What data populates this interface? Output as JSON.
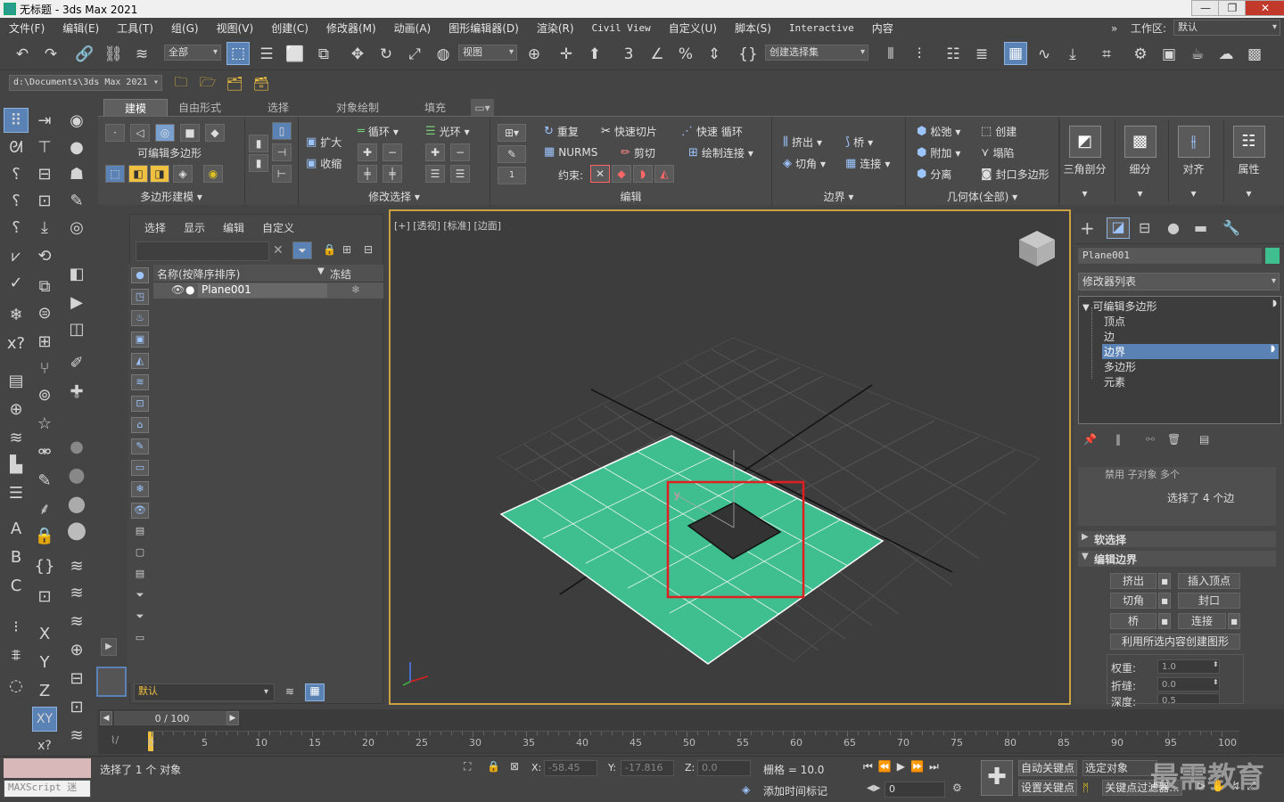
{
  "window": {
    "title": "无标题 - 3ds Max 2021",
    "buttons": [
      "—",
      "❐",
      "✕"
    ]
  },
  "menu": {
    "items": [
      "文件(F)",
      "编辑(E)",
      "工具(T)",
      "组(G)",
      "视图(V)",
      "创建(C)",
      "修改器(M)",
      "动画(A)",
      "图形编辑器(D)",
      "渲染(R)",
      "Civil View",
      "自定义(U)",
      "脚本(S)",
      "Interactive",
      "内容"
    ],
    "more": "»",
    "workspace_label": "工作区:",
    "workspace_value": "默认"
  },
  "toolbar": {
    "selection_filter": "全部",
    "ref_coord": "视图",
    "named_selection": "创建选择集",
    "path": "d:\\Documents\\3ds Max 2021"
  },
  "ribbon": {
    "tabs": [
      "建模",
      "自由形式",
      "选择",
      "对象绘制",
      "填充"
    ],
    "groups": {
      "poly_modeling": {
        "label": "多边形建模",
        "editable_poly": "可编辑多边形"
      },
      "modify_selection": {
        "label": "修改选择",
        "grow": "扩大",
        "shrink": "收缩",
        "loop": "循环",
        "ring": "光环"
      },
      "edit": {
        "label": "编辑",
        "repeat": "重复",
        "quickslice": "快速切片",
        "quickloop": "快速 循环",
        "nurms": "NURMS",
        "cut": "剪切",
        "paintconnect": "绘制连接",
        "constraint": "约束:",
        "spinner_value": "1"
      },
      "borders": {
        "label": "边界",
        "extrude": "挤出",
        "bridge": "桥",
        "chamfer": "切角",
        "connect": "连接"
      },
      "geometry": {
        "label": "几何体(全部)",
        "relax": "松弛",
        "create": "创建",
        "attach": "附加",
        "collapse": "塌陷",
        "detach": "分离",
        "cap_poly": "封口多边形"
      },
      "big_buttons": [
        "三角剖分",
        "细分",
        "对齐",
        "属性"
      ]
    }
  },
  "scene_explorer": {
    "menu": [
      "选择",
      "显示",
      "编辑",
      "自定义"
    ],
    "col_name": "名称(按降序排序)",
    "col_freeze": "冻结",
    "objects": [
      "Plane001"
    ],
    "layer": "默认"
  },
  "viewport": {
    "label": "[+] [透视] [标准] [边面]"
  },
  "command_panel": {
    "object_name": "Plane001",
    "modifier_list": "修改器列表",
    "stack": [
      {
        "label": "可编辑多边形",
        "level": 0,
        "selected": false
      },
      {
        "label": "顶点",
        "level": 1,
        "selected": false
      },
      {
        "label": "边",
        "level": 1,
        "selected": false
      },
      {
        "label": "边界",
        "level": 1,
        "selected": true
      },
      {
        "label": "多边形",
        "level": 1,
        "selected": false
      },
      {
        "label": "元素",
        "level": 1,
        "selected": false
      }
    ],
    "partial_row": "禁用   子对象   多个",
    "selection_info": "选择了 4 个边",
    "soft_selection": "软选择",
    "edit_borders": "编辑边界",
    "buttons": {
      "extrude": "挤出",
      "insert_vertex": "插入顶点",
      "chamfer": "切角",
      "cap": "封口",
      "bridge": "桥",
      "connect": "连接",
      "create_shape": "利用所选内容创建图形"
    },
    "weight_label": "权重:",
    "weight_value": "1.0",
    "crease_label": "折缝:",
    "crease_value": "0.0",
    "depth_label": "深度:",
    "depth_value": "0.5"
  },
  "timeline": {
    "frame_display": "0 / 100",
    "ticks": [
      "0",
      "5",
      "10",
      "15",
      "20",
      "25",
      "30",
      "35",
      "40",
      "45",
      "50",
      "55",
      "60",
      "65",
      "70",
      "75",
      "80",
      "85",
      "90",
      "95",
      "100"
    ]
  },
  "status": {
    "selected": "选择了 1 个 对象",
    "maxscript": "MAXScript 迷",
    "x_label": "X:",
    "x_value": "-58.45",
    "y_label": "Y:",
    "y_value": "-17.816",
    "z_label": "Z:",
    "z_value": "0.0",
    "grid": "栅格 = 10.0",
    "add_time_tag": "添加时间标记",
    "auto_key": "自动关键点",
    "set_key": "设置关键点",
    "selected_obj": "选定对象",
    "key_filters": "关键点过滤器...",
    "frame": "0",
    "watermark": "最需教育"
  },
  "colors": {
    "accent": "#5a82b5",
    "plane_fill": "#3fbf8f",
    "selection_box": "#e02020",
    "viewport_border": "#c9a243",
    "stack_selected": "#5a82b5"
  }
}
